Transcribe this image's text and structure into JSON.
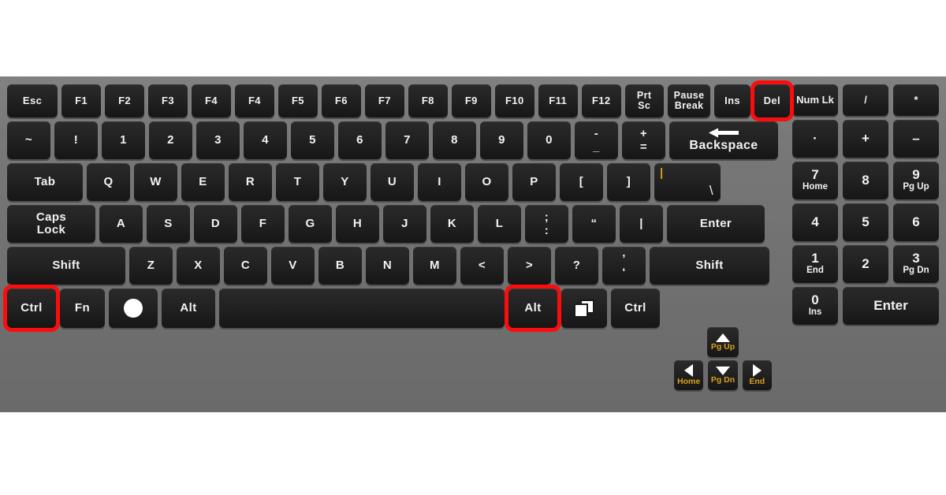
{
  "meta": {
    "title": "Computer keyboard layout diagram",
    "highlight_color": "#fb0d0d",
    "body_color": "#767676",
    "key_color": "#1e1e1e",
    "label_color": "#f2f2f2",
    "secondary_label_color": "#d8a01b",
    "highlighted_keys": [
      "Ctrl",
      "Alt",
      "Del"
    ]
  },
  "function_row": [
    {
      "label": "Esc"
    },
    {
      "label": "F1"
    },
    {
      "label": "F2"
    },
    {
      "label": "F3"
    },
    {
      "label": "F4"
    },
    {
      "label": "F4"
    },
    {
      "label": "F5"
    },
    {
      "label": "F6"
    },
    {
      "label": "F7"
    },
    {
      "label": "F8"
    },
    {
      "label": "F9"
    },
    {
      "label": "F10"
    },
    {
      "label": "F11"
    },
    {
      "label": "F12"
    },
    {
      "label": "Prt\nSc"
    },
    {
      "label": "Pause\nBreak"
    },
    {
      "label": "Ins"
    },
    {
      "label": "Del"
    }
  ],
  "number_row": [
    {
      "label": "~"
    },
    {
      "label": "!"
    },
    {
      "label": "1"
    },
    {
      "label": "2"
    },
    {
      "label": "3"
    },
    {
      "label": "4"
    },
    {
      "label": "5"
    },
    {
      "label": "6"
    },
    {
      "label": "7"
    },
    {
      "label": "8"
    },
    {
      "label": "9"
    },
    {
      "label": "0"
    },
    {
      "top": "-",
      "bottom": "_"
    },
    {
      "top": "+",
      "bottom": "="
    },
    {
      "label": "Backspace"
    }
  ],
  "qwerty_row": [
    {
      "label": "Tab"
    },
    {
      "label": "Q"
    },
    {
      "label": "W"
    },
    {
      "label": "E"
    },
    {
      "label": "R"
    },
    {
      "label": "T"
    },
    {
      "label": "Y"
    },
    {
      "label": "U"
    },
    {
      "label": "I"
    },
    {
      "label": "O"
    },
    {
      "label": "P"
    },
    {
      "label": "["
    },
    {
      "label": "]"
    },
    {
      "corner_top": "|",
      "corner_bottom": "\\"
    }
  ],
  "home_row": [
    {
      "label": "Caps\nLock"
    },
    {
      "label": "A"
    },
    {
      "label": "S"
    },
    {
      "label": "D"
    },
    {
      "label": "F"
    },
    {
      "label": "G"
    },
    {
      "label": "H"
    },
    {
      "label": "J"
    },
    {
      "label": "K"
    },
    {
      "label": "L"
    },
    {
      "top": ";",
      "bottom": ":"
    },
    {
      "label": "“"
    },
    {
      "label": "|"
    },
    {
      "label": "Enter"
    }
  ],
  "shift_row": [
    {
      "label": "Shift"
    },
    {
      "label": "Z"
    },
    {
      "label": "X"
    },
    {
      "label": "C"
    },
    {
      "label": "V"
    },
    {
      "label": "B"
    },
    {
      "label": "N"
    },
    {
      "label": "M"
    },
    {
      "label": "<"
    },
    {
      "label": ">"
    },
    {
      "label": "?"
    },
    {
      "top": "’",
      "bottom": "‘"
    },
    {
      "label": "Shift"
    }
  ],
  "bottom_row": [
    {
      "label": "Ctrl"
    },
    {
      "label": "Fn"
    },
    {
      "label": "",
      "icon": "windows-circle-icon"
    },
    {
      "label": "Alt"
    },
    {
      "label": "",
      "icon": "spacebar"
    },
    {
      "label": "Alt"
    },
    {
      "label": "",
      "icon": "context-menu-icon"
    },
    {
      "label": "Ctrl"
    }
  ],
  "numpad": {
    "row1": [
      {
        "label": "Num Lk"
      },
      {
        "label": "/"
      },
      {
        "label": "*"
      }
    ],
    "row2": [
      {
        "label": "·"
      },
      {
        "label": "+"
      },
      {
        "label": "–"
      }
    ],
    "row3": [
      {
        "big": "7",
        "small": "Home"
      },
      {
        "big": "8",
        "small": ""
      },
      {
        "big": "9",
        "small": "Pg Up"
      }
    ],
    "row4": [
      {
        "big": "4",
        "small": ""
      },
      {
        "big": "5",
        "small": ""
      },
      {
        "big": "6",
        "small": ""
      }
    ],
    "row5": [
      {
        "big": "1",
        "small": "End"
      },
      {
        "big": "2",
        "small": ""
      },
      {
        "big": "3",
        "small": "Pg Dn"
      }
    ],
    "row6": [
      {
        "big": "0",
        "small": "Ins"
      },
      {
        "big": "Enter",
        "small": ""
      }
    ]
  },
  "arrow_cluster": {
    "up": {
      "glyph": "▲",
      "sub": "Pg Up"
    },
    "left": {
      "glyph": "◀",
      "sub": "Home"
    },
    "down": {
      "glyph": "▼",
      "sub": "Pg Dn"
    },
    "right": {
      "glyph": "▶",
      "sub": "End"
    }
  }
}
